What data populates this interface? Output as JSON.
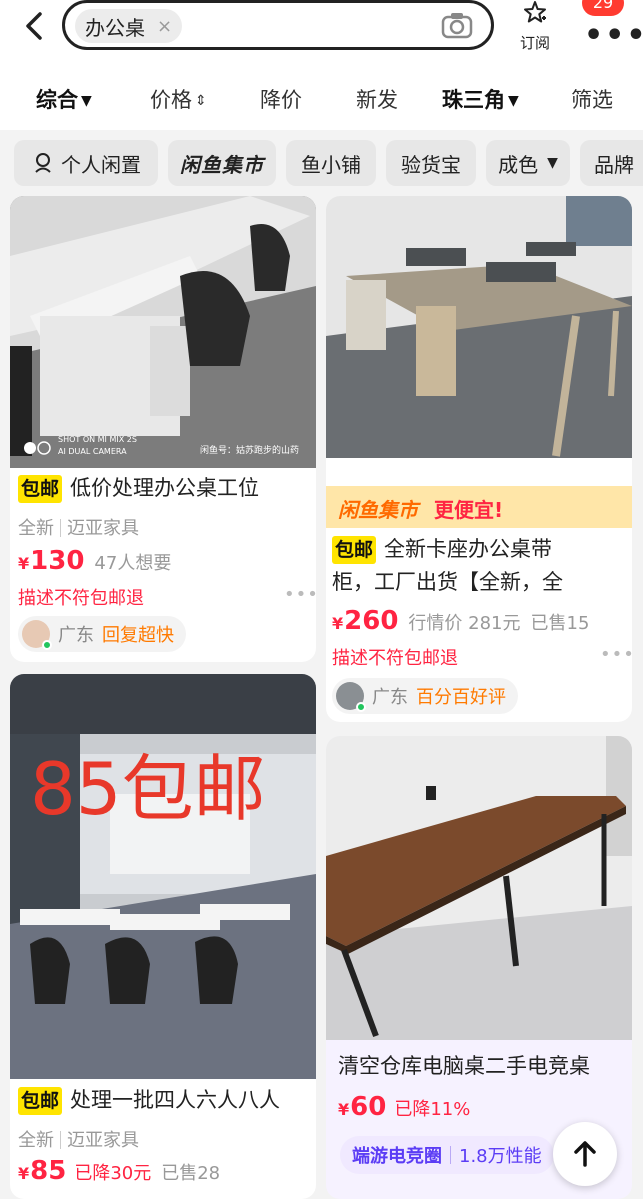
{
  "search": {
    "query": "办公桌",
    "clear": "×"
  },
  "header": {
    "subscribe_label": "订阅",
    "more_badge": "29"
  },
  "sort_tabs": [
    {
      "label": "综合",
      "icon": "chevron-down-icon"
    },
    {
      "label": "价格",
      "icon": "sort-updown-icon"
    },
    {
      "label": "降价"
    },
    {
      "label": "新发"
    },
    {
      "label": "珠三角",
      "icon": "chevron-down-icon"
    },
    {
      "label": "筛选"
    }
  ],
  "filter_chips": [
    {
      "label": "个人闲置",
      "icon": "person-icon"
    },
    {
      "label": "闲鱼集市"
    },
    {
      "label": "鱼小铺"
    },
    {
      "label": "验货宝"
    },
    {
      "label": "成色",
      "icon": "chevron-down-icon"
    },
    {
      "label": "品牌"
    }
  ],
  "cards": [
    {
      "tag": "包邮",
      "title": "低价处理办公桌工位",
      "condition": "全新",
      "shop": "迈亚家具",
      "price": "130",
      "yen": "¥",
      "want": "47人想要",
      "warn": "描述不符包邮退",
      "region": "广东",
      "seller_badge": "回复超快",
      "photo_caption_1": "SHOT ON MI MIX 2S",
      "photo_caption_2": "AI DUAL CAMERA",
      "photo_watermark": "闲鱼号：姑苏跑步的山药"
    },
    {
      "banner_brand": "闲鱼集市",
      "banner_text": "更便宜!",
      "tag": "包邮",
      "title_1": "全新卡座办公桌带",
      "title_2": "柜，工厂出货【全新，全",
      "price": "260",
      "yen": "¥",
      "market": "行情价 281元",
      "sold": "已售15",
      "warn": "描述不符包邮退",
      "region": "广东",
      "seller_badge": "百分百好评"
    },
    {
      "handwritten": "85包邮",
      "tag": "包邮",
      "title": "处理一批四人六人八人",
      "condition": "全新",
      "shop": "迈亚家具",
      "price": "85",
      "yen": "¥",
      "drop": "已降30元",
      "sold": "已售28"
    },
    {
      "title": "清空仓库电脑桌二手电竞桌",
      "price": "60",
      "yen": "¥",
      "drop": "已降11%",
      "community_name": "端游电竞圈",
      "community_desc": "1.8万性能"
    }
  ]
}
